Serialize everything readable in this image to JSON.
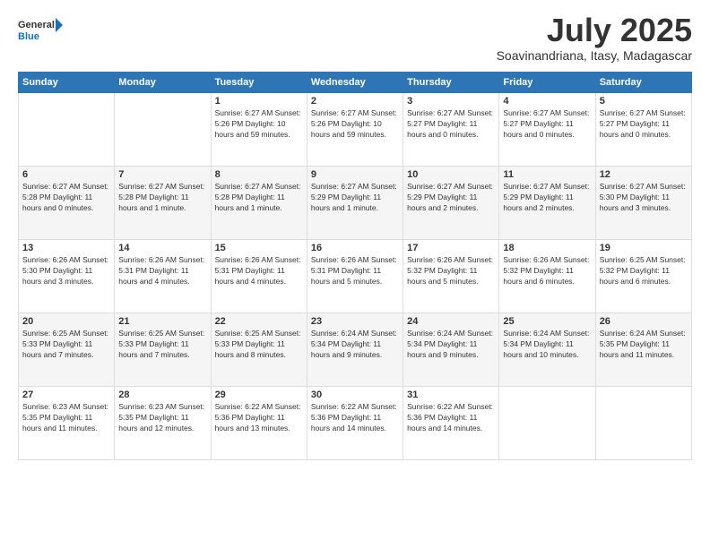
{
  "header": {
    "logo_general": "General",
    "logo_blue": "Blue",
    "month_year": "July 2025",
    "location": "Soavinandriana, Itasy, Madagascar"
  },
  "days_of_week": [
    "Sunday",
    "Monday",
    "Tuesday",
    "Wednesday",
    "Thursday",
    "Friday",
    "Saturday"
  ],
  "weeks": [
    [
      {
        "day": "",
        "info": ""
      },
      {
        "day": "",
        "info": ""
      },
      {
        "day": "1",
        "info": "Sunrise: 6:27 AM\nSunset: 5:26 PM\nDaylight: 10 hours\nand 59 minutes."
      },
      {
        "day": "2",
        "info": "Sunrise: 6:27 AM\nSunset: 5:26 PM\nDaylight: 10 hours\nand 59 minutes."
      },
      {
        "day": "3",
        "info": "Sunrise: 6:27 AM\nSunset: 5:27 PM\nDaylight: 11 hours\nand 0 minutes."
      },
      {
        "day": "4",
        "info": "Sunrise: 6:27 AM\nSunset: 5:27 PM\nDaylight: 11 hours\nand 0 minutes."
      },
      {
        "day": "5",
        "info": "Sunrise: 6:27 AM\nSunset: 5:27 PM\nDaylight: 11 hours\nand 0 minutes."
      }
    ],
    [
      {
        "day": "6",
        "info": "Sunrise: 6:27 AM\nSunset: 5:28 PM\nDaylight: 11 hours\nand 0 minutes."
      },
      {
        "day": "7",
        "info": "Sunrise: 6:27 AM\nSunset: 5:28 PM\nDaylight: 11 hours\nand 1 minute."
      },
      {
        "day": "8",
        "info": "Sunrise: 6:27 AM\nSunset: 5:28 PM\nDaylight: 11 hours\nand 1 minute."
      },
      {
        "day": "9",
        "info": "Sunrise: 6:27 AM\nSunset: 5:29 PM\nDaylight: 11 hours\nand 1 minute."
      },
      {
        "day": "10",
        "info": "Sunrise: 6:27 AM\nSunset: 5:29 PM\nDaylight: 11 hours\nand 2 minutes."
      },
      {
        "day": "11",
        "info": "Sunrise: 6:27 AM\nSunset: 5:29 PM\nDaylight: 11 hours\nand 2 minutes."
      },
      {
        "day": "12",
        "info": "Sunrise: 6:27 AM\nSunset: 5:30 PM\nDaylight: 11 hours\nand 3 minutes."
      }
    ],
    [
      {
        "day": "13",
        "info": "Sunrise: 6:26 AM\nSunset: 5:30 PM\nDaylight: 11 hours\nand 3 minutes."
      },
      {
        "day": "14",
        "info": "Sunrise: 6:26 AM\nSunset: 5:31 PM\nDaylight: 11 hours\nand 4 minutes."
      },
      {
        "day": "15",
        "info": "Sunrise: 6:26 AM\nSunset: 5:31 PM\nDaylight: 11 hours\nand 4 minutes."
      },
      {
        "day": "16",
        "info": "Sunrise: 6:26 AM\nSunset: 5:31 PM\nDaylight: 11 hours\nand 5 minutes."
      },
      {
        "day": "17",
        "info": "Sunrise: 6:26 AM\nSunset: 5:32 PM\nDaylight: 11 hours\nand 5 minutes."
      },
      {
        "day": "18",
        "info": "Sunrise: 6:26 AM\nSunset: 5:32 PM\nDaylight: 11 hours\nand 6 minutes."
      },
      {
        "day": "19",
        "info": "Sunrise: 6:25 AM\nSunset: 5:32 PM\nDaylight: 11 hours\nand 6 minutes."
      }
    ],
    [
      {
        "day": "20",
        "info": "Sunrise: 6:25 AM\nSunset: 5:33 PM\nDaylight: 11 hours\nand 7 minutes."
      },
      {
        "day": "21",
        "info": "Sunrise: 6:25 AM\nSunset: 5:33 PM\nDaylight: 11 hours\nand 7 minutes."
      },
      {
        "day": "22",
        "info": "Sunrise: 6:25 AM\nSunset: 5:33 PM\nDaylight: 11 hours\nand 8 minutes."
      },
      {
        "day": "23",
        "info": "Sunrise: 6:24 AM\nSunset: 5:34 PM\nDaylight: 11 hours\nand 9 minutes."
      },
      {
        "day": "24",
        "info": "Sunrise: 6:24 AM\nSunset: 5:34 PM\nDaylight: 11 hours\nand 9 minutes."
      },
      {
        "day": "25",
        "info": "Sunrise: 6:24 AM\nSunset: 5:34 PM\nDaylight: 11 hours\nand 10 minutes."
      },
      {
        "day": "26",
        "info": "Sunrise: 6:24 AM\nSunset: 5:35 PM\nDaylight: 11 hours\nand 11 minutes."
      }
    ],
    [
      {
        "day": "27",
        "info": "Sunrise: 6:23 AM\nSunset: 5:35 PM\nDaylight: 11 hours\nand 11 minutes."
      },
      {
        "day": "28",
        "info": "Sunrise: 6:23 AM\nSunset: 5:35 PM\nDaylight: 11 hours\nand 12 minutes."
      },
      {
        "day": "29",
        "info": "Sunrise: 6:22 AM\nSunset: 5:36 PM\nDaylight: 11 hours\nand 13 minutes."
      },
      {
        "day": "30",
        "info": "Sunrise: 6:22 AM\nSunset: 5:36 PM\nDaylight: 11 hours\nand 14 minutes."
      },
      {
        "day": "31",
        "info": "Sunrise: 6:22 AM\nSunset: 5:36 PM\nDaylight: 11 hours\nand 14 minutes."
      },
      {
        "day": "",
        "info": ""
      },
      {
        "day": "",
        "info": ""
      }
    ]
  ]
}
